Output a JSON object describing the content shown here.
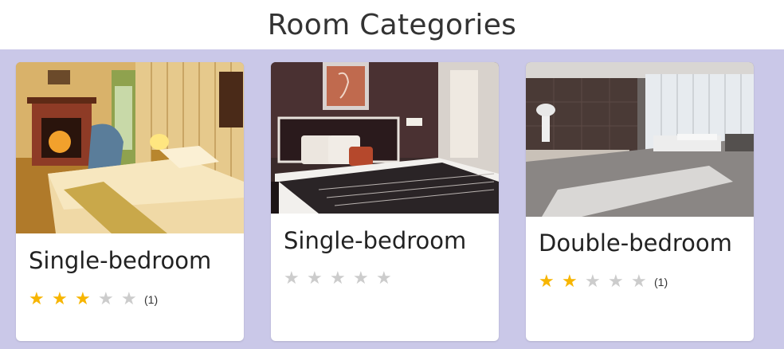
{
  "page": {
    "title": "Room Categories"
  },
  "colors": {
    "band": "#cac8e8",
    "star_on": "#f7b500",
    "star_off": "#cccccc"
  },
  "cards": [
    {
      "name": "Single-bedroom",
      "rating": 3,
      "max_rating": 5,
      "review_count": "(1)",
      "star_glyph": "★"
    },
    {
      "name": "Single-bedroom",
      "rating": 0,
      "max_rating": 5,
      "review_count": "",
      "star_glyph": "★"
    },
    {
      "name": "Double-bedroom",
      "rating": 2,
      "max_rating": 5,
      "review_count": "(1)",
      "star_glyph": "★"
    }
  ]
}
